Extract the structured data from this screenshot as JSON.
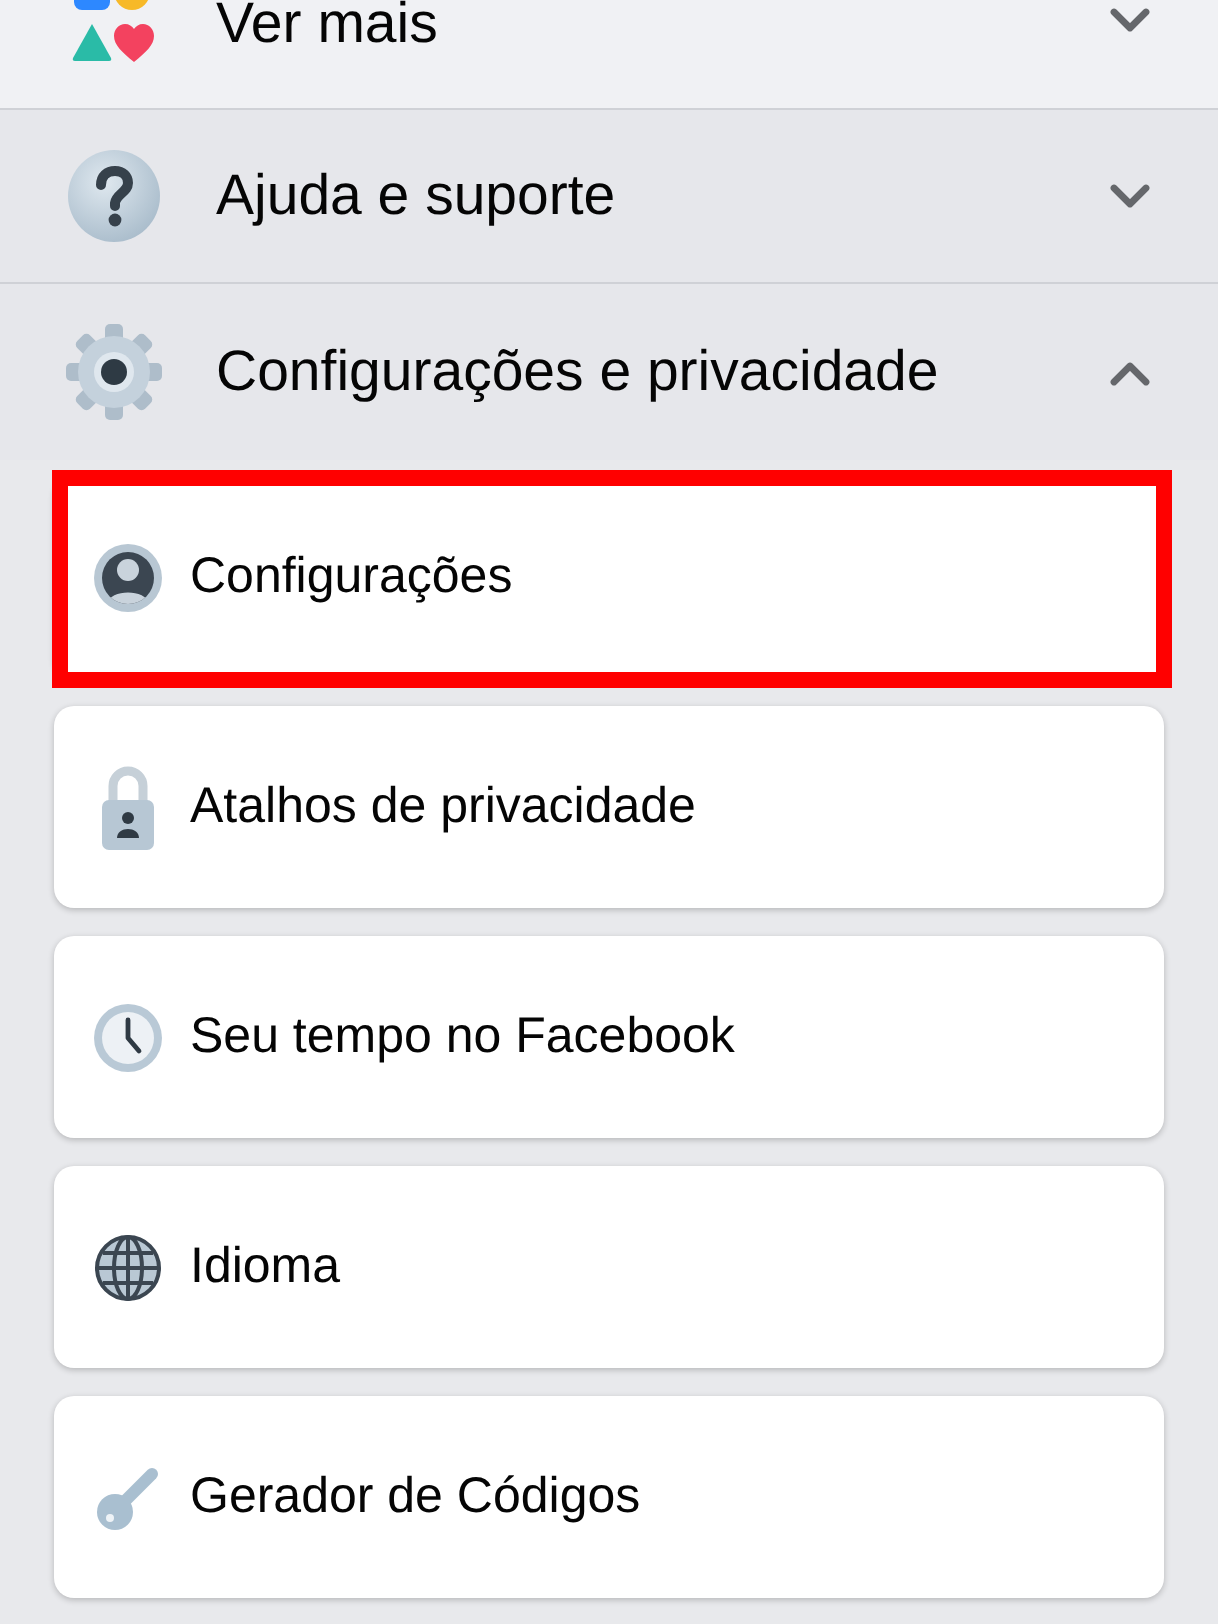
{
  "sections": [
    {
      "label": "Ver mais",
      "kind": "shapes",
      "expanded": false
    },
    {
      "label": "Ajuda e suporte",
      "kind": "help",
      "expanded": false
    },
    {
      "label": "Configurações e privacidade",
      "kind": "gear",
      "expanded": true,
      "items": [
        {
          "label": "Configurações",
          "kind": "profile",
          "highlighted": true
        },
        {
          "label": "Atalhos de privacidade",
          "kind": "lock",
          "highlighted": false
        },
        {
          "label": "Seu tempo no Facebook",
          "kind": "clock",
          "highlighted": false
        },
        {
          "label": "Idioma",
          "kind": "globe",
          "highlighted": false
        },
        {
          "label": "Gerador de Códigos",
          "kind": "key",
          "highlighted": false
        }
      ]
    }
  ]
}
